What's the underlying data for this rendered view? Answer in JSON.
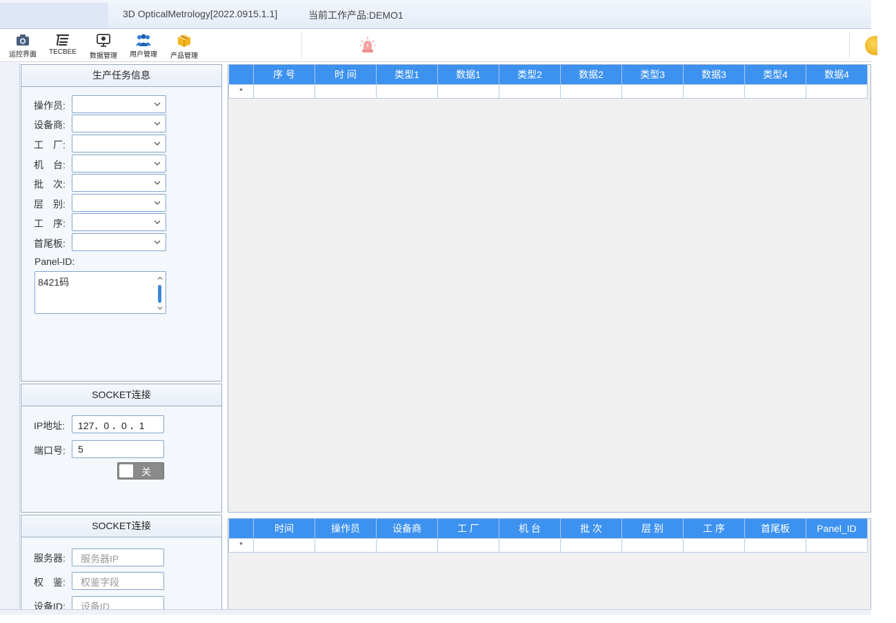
{
  "window": {
    "title": "3D OpticalMetrology[2022.0915.1.1]",
    "current_product": "当前工作产品:DEMO1"
  },
  "toolbar": {
    "items": [
      {
        "label": "运控界面",
        "icon": "camera-icon"
      },
      {
        "label": "TECBEE",
        "icon": "tecbee-logo-icon"
      },
      {
        "label": "数据管理",
        "icon": "data-monitor-icon"
      },
      {
        "label": "用户管理",
        "icon": "users-icon"
      },
      {
        "label": "产品管理",
        "icon": "product-box-icon"
      }
    ],
    "alarm_icon": "alarm-light-icon",
    "colors": {
      "accent": "#3d92f0",
      "alarm": "#f28a8a"
    }
  },
  "task_panel": {
    "title": "生产任务信息",
    "fields": [
      {
        "label": "操作员:",
        "value": ""
      },
      {
        "label": "设备商:",
        "value": ""
      },
      {
        "label": "工　厂:",
        "value": ""
      },
      {
        "label": "机　台:",
        "value": ""
      },
      {
        "label": "批　次:",
        "value": ""
      },
      {
        "label": "层　别:",
        "value": ""
      },
      {
        "label": "工　序:",
        "value": ""
      },
      {
        "label": "首尾板:",
        "value": ""
      }
    ],
    "panel_id_label": "Panel-ID:",
    "panel_id_value": "8421码"
  },
  "socket_panel": {
    "title": "SOCKET连接",
    "ip_label": "IP地址:",
    "ip_value": "127．0 ．0 ．1",
    "port_label": "端口号:",
    "port_value": "5",
    "toggle_label": "关"
  },
  "server_panel": {
    "title": "SOCKET连接",
    "server_label": "服务器:",
    "server_placeholder": "服务器IP",
    "auth_label": "权　鉴:",
    "auth_placeholder": "权鉴字段",
    "device_label": "设备ID:",
    "device_placeholder": "设备ID"
  },
  "data_grid": {
    "columns": [
      "序 号",
      "时 间",
      "类型1",
      "数据1",
      "类型2",
      "数据2",
      "类型3",
      "数据3",
      "类型4",
      "数据4"
    ],
    "new_row_marker": "*"
  },
  "task_grid": {
    "columns": [
      "时间",
      "操作员",
      "设备商",
      "工 厂",
      "机 台",
      "批 次",
      "层 别",
      "工 序",
      "首尾板",
      "Panel_ID"
    ],
    "new_row_marker": "*"
  }
}
